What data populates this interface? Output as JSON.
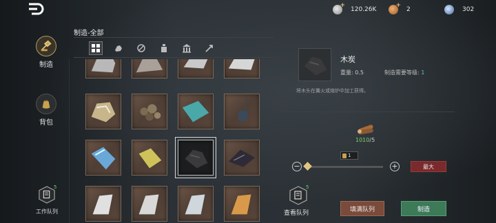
{
  "currencies": [
    {
      "name": "silver-coin",
      "value": "120.26K",
      "has_plus": true
    },
    {
      "name": "gold-coin",
      "value": "2",
      "has_plus": true
    },
    {
      "name": "gem",
      "value": "302",
      "has_plus": false
    }
  ],
  "nav": {
    "craft_label": "制造",
    "bag_label": "背包",
    "work_queue_label": "工作队列",
    "work_queue_badge": "5"
  },
  "craft": {
    "title": "制造-全部",
    "categories": [
      "all",
      "ore",
      "wood",
      "potion",
      "building",
      "arrow"
    ]
  },
  "grid_items": [
    {
      "name": "silver-ore",
      "row": 0,
      "col": 0
    },
    {
      "name": "stone-pile",
      "row": 0,
      "col": 1
    },
    {
      "name": "iron-ingot",
      "row": 0,
      "col": 2
    },
    {
      "name": "steel-plate",
      "row": 0,
      "col": 3
    },
    {
      "name": "gold-ore",
      "row": 1,
      "col": 0
    },
    {
      "name": "gravel",
      "row": 1,
      "col": 1
    },
    {
      "name": "teal-cloth",
      "row": 1,
      "col": 2
    },
    {
      "name": "shovel",
      "row": 1,
      "col": 3
    },
    {
      "name": "blue-crystal",
      "row": 2,
      "col": 0
    },
    {
      "name": "sulfur",
      "row": 2,
      "col": 1
    },
    {
      "name": "charcoal",
      "row": 2,
      "col": 2,
      "selected": true
    },
    {
      "name": "obsidian",
      "row": 2,
      "col": 3
    },
    {
      "name": "silver-ingot",
      "row": 3,
      "col": 0
    },
    {
      "name": "tin-ingot",
      "row": 3,
      "col": 1
    },
    {
      "name": "refined-ingot",
      "row": 3,
      "col": 2
    },
    {
      "name": "copper-ingot",
      "row": 3,
      "col": 3
    }
  ],
  "detail": {
    "name": "木炭",
    "weight_label": "重量:",
    "weight_value": "0.5",
    "level_label": "制造需要等级:",
    "level_value": "1",
    "description": "将木头在篝火或熔炉中加工获得。",
    "material_have": "1010",
    "material_sep": "/",
    "material_need": "5",
    "quantity": "1",
    "max_label": "最大",
    "queue_label": "查看队列",
    "queue_badge": "5",
    "fill_label": "填满队列",
    "craft_label": "制造"
  },
  "colors": {
    "fill_button": "#7a4a3a",
    "craft_button": "#3d7a58",
    "max_button": "#7a2a2c",
    "material_count": "#7fd36b"
  }
}
